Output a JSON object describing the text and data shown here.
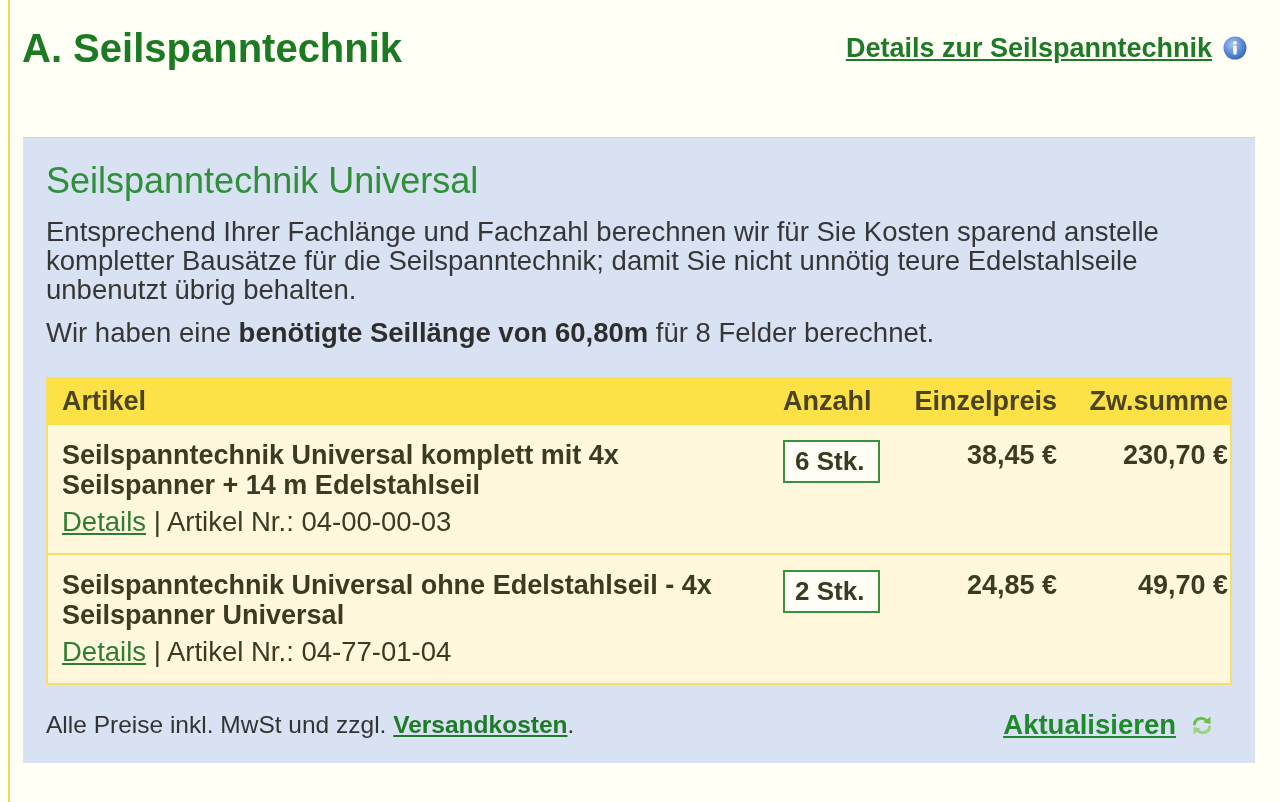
{
  "section": {
    "title": "A. Seilspanntechnik",
    "details_link": "Details zur Seilspanntechnik"
  },
  "panel": {
    "heading": "Seilspanntechnik Universal",
    "description": "Entsprechend Ihrer Fachlänge und Fachzahl berechnen wir für Sie Kosten sparend anstelle kompletter Bausätze für die Seilspanntechnik; damit Sie nicht unnötig teure Edelstahlseile unbenutzt übrig behalten.",
    "summary": "Wir haben eine **benötigte Seillänge von 60,80m** für 8 Felder berechnet.",
    "table": {
      "columns": [
        "Artikel",
        "Anzahl",
        "Einzelpreis",
        "Zw.summe"
      ],
      "rows": [
        {
          "name": "Seilspanntechnik Universal komplett mit 4x Seilspanner + 14 m Edelstahlseil",
          "details_link": "Details",
          "article_info": "| Artikel Nr.: 04-00-00-03",
          "quantity": "6 Stk.",
          "unit_price": "38,45 €",
          "subtotal": "230,70 €"
        },
        {
          "name": "Seilspanntechnik Universal ohne Edelstahlseil - 4x Seilspanner Universal",
          "details_link": "Details",
          "article_info": "| Artikel Nr.: 04-77-01-04",
          "quantity": "2 Stk.",
          "unit_price": "24,85 €",
          "subtotal": "49,70 €"
        }
      ]
    },
    "footer": {
      "note": "Alle Preise inkl. MwSt und zzgl.",
      "shipping_link": "Versandkosten",
      "note_end": ".",
      "update_link": "Aktualisieren"
    }
  }
}
